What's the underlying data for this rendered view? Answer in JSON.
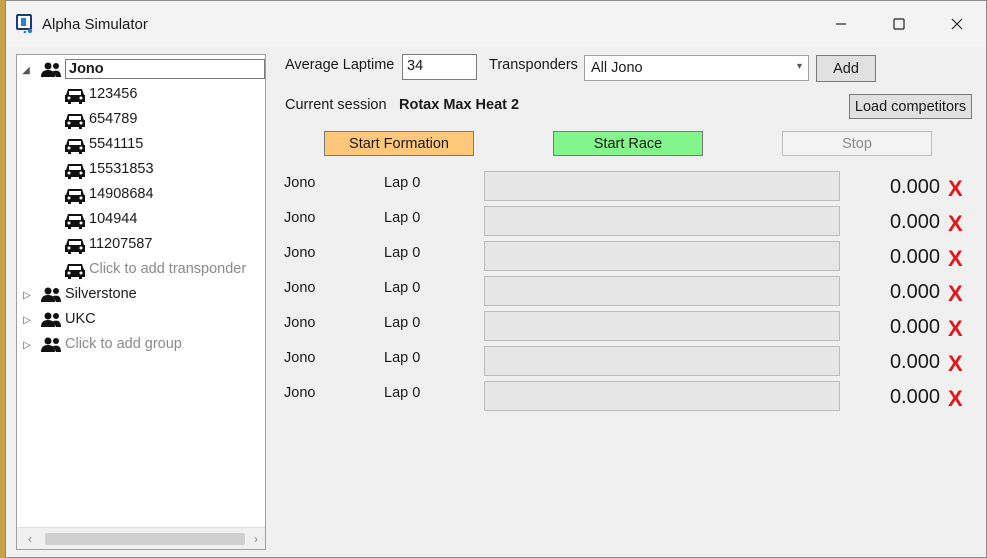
{
  "window": {
    "title": "Alpha Simulator"
  },
  "tree": {
    "groups": [
      {
        "name": "Jono",
        "transponders": [
          "123456",
          "654789",
          "5541115",
          "15531853",
          "14908684",
          "104944",
          "11207587"
        ],
        "add_transponder_hint": "Click to add transponder"
      },
      {
        "name": "Silverstone"
      },
      {
        "name": "UKC"
      }
    ],
    "add_group_hint": "Click to add group"
  },
  "controls": {
    "avg_laptime_label": "Average Laptime",
    "avg_laptime_value": "34",
    "transponders_label": "Transponders",
    "transponders_selected": "All Jono",
    "add_label": "Add",
    "current_session_label": "Current session",
    "current_session_value": "Rotax Max Heat 2",
    "load_competitors_label": "Load competitors",
    "start_formation_label": "Start Formation",
    "start_race_label": "Start Race",
    "stop_label": "Stop"
  },
  "colors": {
    "start_formation": "#ffc77a",
    "start_race": "#84f58a",
    "remove_x": "#e3161b"
  },
  "race_rows": [
    {
      "name": "Jono",
      "lap": "Lap 0",
      "time": "0.000",
      "remove": "X"
    },
    {
      "name": "Jono",
      "lap": "Lap 0",
      "time": "0.000",
      "remove": "X"
    },
    {
      "name": "Jono",
      "lap": "Lap 0",
      "time": "0.000",
      "remove": "X"
    },
    {
      "name": "Jono",
      "lap": "Lap 0",
      "time": "0.000",
      "remove": "X"
    },
    {
      "name": "Jono",
      "lap": "Lap 0",
      "time": "0.000",
      "remove": "X"
    },
    {
      "name": "Jono",
      "lap": "Lap 0",
      "time": "0.000",
      "remove": "X"
    },
    {
      "name": "Jono",
      "lap": "Lap 0",
      "time": "0.000",
      "remove": "X"
    }
  ]
}
